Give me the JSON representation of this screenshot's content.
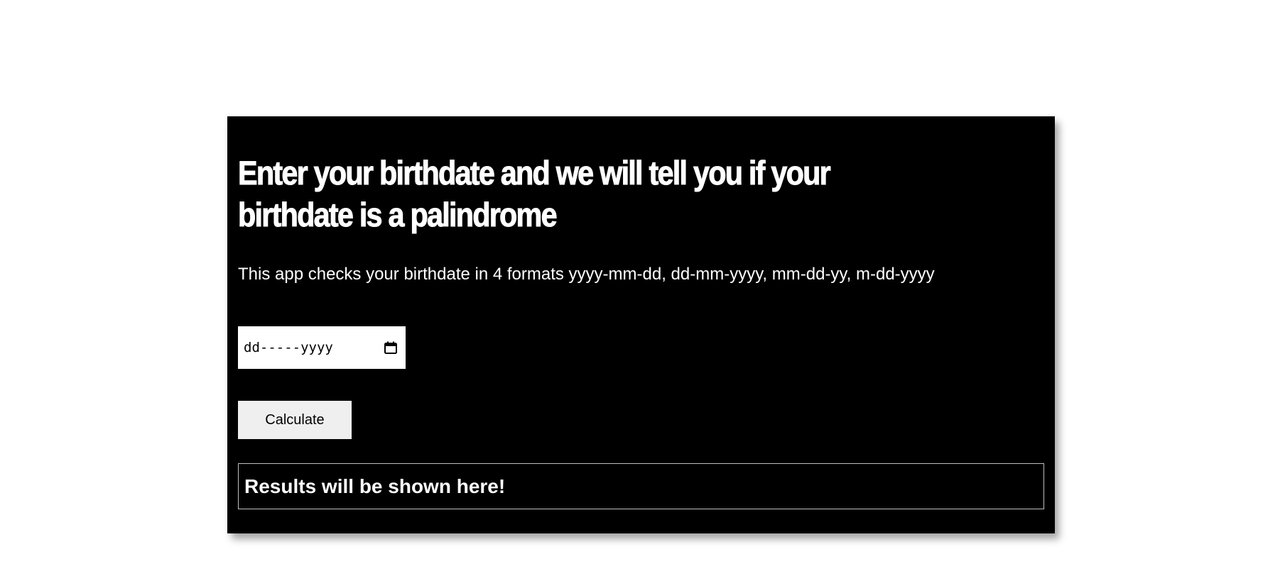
{
  "main": {
    "title": "Enter your birthdate and we will tell you if your birthdate is a palindrome",
    "subtitle": "This app checks your birthdate in 4 formats yyyy-mm-dd, dd-mm-yyyy, mm-dd-yy, m-dd-yyyy",
    "date_input": {
      "placeholder": "dd-----yyyy",
      "icon": "calendar-icon"
    },
    "calculate_label": "Calculate",
    "result_text": "Results will be shown here!"
  },
  "colors": {
    "card_background": "#000000",
    "page_background": "#ffffff",
    "text": "#ffffff",
    "button_background": "#efefef",
    "result_border": "#bfbfbf"
  }
}
